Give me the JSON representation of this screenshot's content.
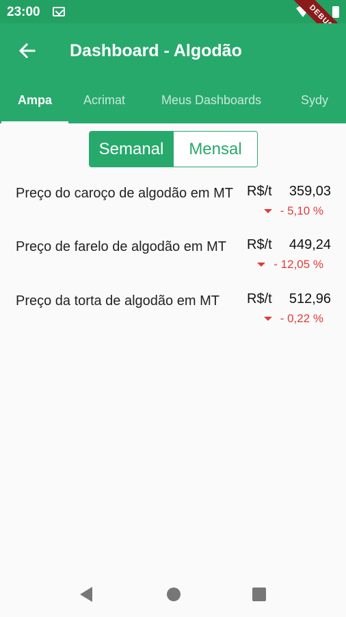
{
  "status_bar": {
    "time": "23:00",
    "debug_label": "DEBUG"
  },
  "app_bar": {
    "title": "Dashboard - Algodão"
  },
  "tabs": [
    {
      "label": "Ampa",
      "active": true
    },
    {
      "label": "Acrimat",
      "active": false
    },
    {
      "label": "Meus Dashboards",
      "active": false
    },
    {
      "label": "Sydy",
      "active": false
    }
  ],
  "period_toggle": {
    "weekly": "Semanal",
    "monthly": "Mensal",
    "selected": "Semanal"
  },
  "prices": [
    {
      "label": "Preço do caroço de algodão em MT",
      "unit": "R$/t",
      "value": "359,03",
      "change": "- 5,10 %"
    },
    {
      "label": "Preço de farelo de algodão em MT",
      "unit": "R$/t",
      "value": "449,24",
      "change": "- 12,05 %"
    },
    {
      "label": "Preço da torta de algodão em MT",
      "unit": "R$/t",
      "value": "512,96",
      "change": "- 0,22 %"
    }
  ],
  "colors": {
    "primary": "#27a96c",
    "status_bar": "#23a163",
    "negative": "#e53935"
  }
}
